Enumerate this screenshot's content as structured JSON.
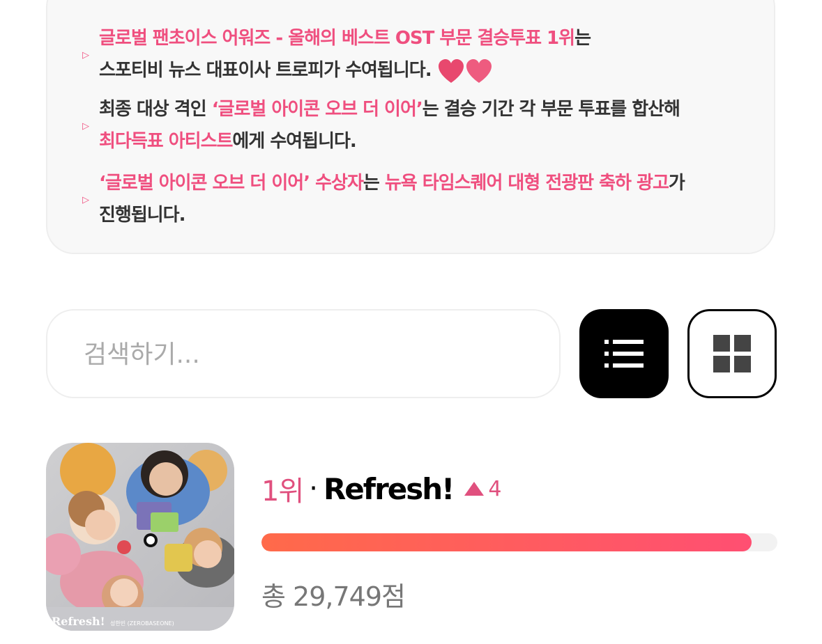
{
  "info_card": {
    "items": [
      {
        "line1": [
          {
            "text": "글로벌 팬초이스 어워즈 - 올해의 베스트 OST 부문 결승투표 1위",
            "pink": true
          },
          {
            "text": "는",
            "pink": false
          }
        ],
        "line2": [
          {
            "text": "스포티비 뉴스 대표이사 트로피가 수여됩니다.",
            "pink": false
          }
        ]
      },
      {
        "line1": [
          {
            "text": "최종 대상 격인 ",
            "pink": false
          },
          {
            "text": "‘글로벌 아이콘 오브 더 이어’",
            "pink": true
          },
          {
            "text": "는 결승 기간 각 부문 투표를 합산해",
            "pink": false
          }
        ],
        "line2": [
          {
            "text": "최다득표 아티스트",
            "pink": true
          },
          {
            "text": "에게 수여됩니다.",
            "pink": false
          }
        ]
      },
      {
        "line1": [
          {
            "text": "‘글로벌 아이콘 오브 더 이어’ 수상자",
            "pink": true
          },
          {
            "text": "는 ",
            "pink": false
          },
          {
            "text": "뉴욕 타임스퀘어 대형 전광판 축하 광고",
            "pink": true
          },
          {
            "text": "가",
            "pink": false
          }
        ],
        "line2": [
          {
            "text": "진행됩니다.",
            "pink": false
          }
        ]
      }
    ]
  },
  "search": {
    "placeholder": "검색하기..."
  },
  "view_toggle": {
    "list_icon": "list-icon",
    "grid_icon": "grid-icon",
    "active": "list"
  },
  "ranking": {
    "rank": "1위",
    "separator": "·",
    "title": "Refresh!",
    "change": "4",
    "change_direction": "up",
    "progress_fraction": 0.95,
    "total": "총 29,749점"
  },
  "colors": {
    "accent": "#ef4f7f",
    "progress_start": "#ff6a4a",
    "progress_end": "#ff4f72"
  }
}
